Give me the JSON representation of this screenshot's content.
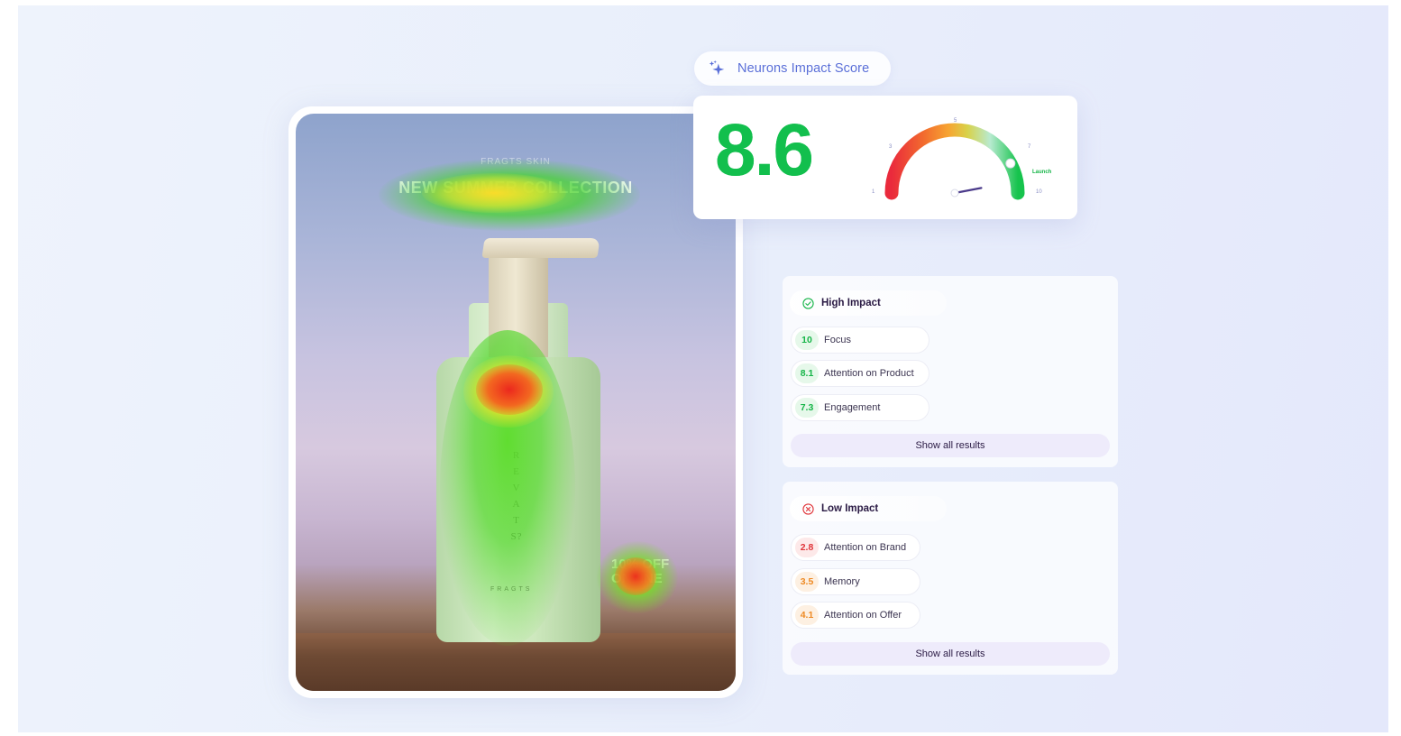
{
  "ad": {
    "brand_top": "FRAGTS SKIN",
    "headline": "NEW SUMMER COLLECTION",
    "bottle_brand_vertical": "REVATS?",
    "bottle_brand_small": "FRAGTS",
    "offer_line1": "10% OFF",
    "offer_line2": "ONLINE"
  },
  "score": {
    "pill_label": "Neurons Impact Score",
    "value": "8.6",
    "gauge": {
      "min": 1,
      "max": 10,
      "value": 8.6,
      "ticks": [
        "1",
        "3",
        "5",
        "7",
        "10"
      ],
      "launch_label": "Launch"
    }
  },
  "high_impact": {
    "title": "High Impact",
    "metrics": [
      {
        "score": "10",
        "label": "Focus"
      },
      {
        "score": "8.1",
        "label": "Attention on Product"
      },
      {
        "score": "7.3",
        "label": "Engagement"
      }
    ],
    "show_all_label": "Show all results"
  },
  "low_impact": {
    "title": "Low Impact",
    "metrics": [
      {
        "score": "2.8",
        "label": "Attention on Brand",
        "color": "red"
      },
      {
        "score": "3.5",
        "label": "Memory",
        "color": "orange"
      },
      {
        "score": "4.1",
        "label": "Attention on Offer",
        "color": "orange"
      }
    ],
    "show_all_label": "Show all results"
  },
  "colors": {
    "score_green": "#12bf4d",
    "accent_blue": "#5a6fd8",
    "button_bg": "#eeebfb",
    "red": "#e0353a",
    "orange": "#ee8a24"
  }
}
